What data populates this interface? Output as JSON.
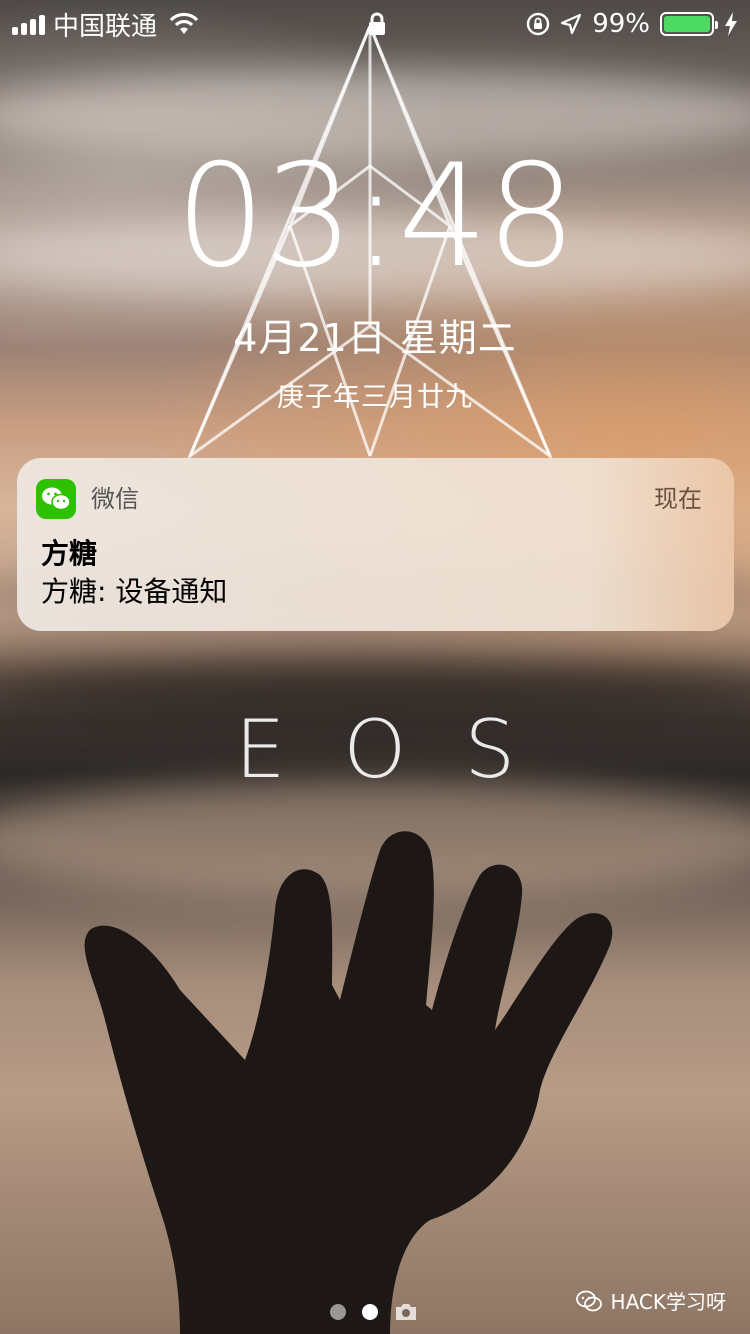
{
  "status_bar": {
    "carrier": "中国联通",
    "battery_percent": "99%",
    "battery_level": 0.99,
    "battery_color": "#4cd964",
    "icons": [
      "signal-icon",
      "wifi-icon",
      "lock-icon",
      "orientation-lock-icon",
      "location-icon",
      "battery-icon",
      "charging-icon"
    ]
  },
  "lockscreen": {
    "time": "03:48",
    "date": "4月21日 星期二",
    "lunar_date": "庚子年三月廿九"
  },
  "notification": {
    "app_name": "微信",
    "time": "现在",
    "title": "方糖",
    "body": "方糖: 设备通知",
    "app_icon": "wechat-icon",
    "app_color": "#2dc100"
  },
  "wallpaper": {
    "text": "EOS"
  },
  "page_indicator": {
    "pages": 2,
    "active": 1,
    "camera_icon": "camera-icon"
  },
  "watermark": {
    "text": "HACK学习呀",
    "icon": "wechat-icon"
  }
}
